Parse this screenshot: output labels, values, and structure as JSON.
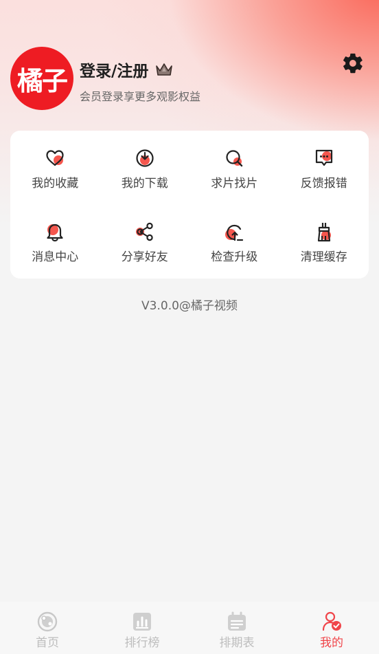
{
  "header": {
    "logo_text": "橘子",
    "login_title": "登录/注册",
    "login_subtitle": "会员登录享更多观影权益"
  },
  "menu": {
    "items": [
      {
        "label": "我的收藏",
        "icon": "heart-icon"
      },
      {
        "label": "我的下载",
        "icon": "download-icon"
      },
      {
        "label": "求片找片",
        "icon": "search-film-icon"
      },
      {
        "label": "反馈报错",
        "icon": "feedback-icon"
      },
      {
        "label": "消息中心",
        "icon": "bell-icon"
      },
      {
        "label": "分享好友",
        "icon": "share-icon"
      },
      {
        "label": "检查升级",
        "icon": "upgrade-icon"
      },
      {
        "label": "清理缓存",
        "icon": "broom-icon"
      }
    ]
  },
  "version": "V3.0.0@橘子视频",
  "tabbar": {
    "tabs": [
      {
        "label": "首页",
        "icon": "home-icon",
        "active": false
      },
      {
        "label": "排行榜",
        "icon": "ranking-icon",
        "active": false
      },
      {
        "label": "排期表",
        "icon": "calendar-icon",
        "active": false
      },
      {
        "label": "我的",
        "icon": "profile-icon",
        "active": true
      }
    ]
  },
  "colors": {
    "accent": "#f0454a",
    "logo_bg": "#ee1c23",
    "icon_dot": "#f5574e"
  }
}
